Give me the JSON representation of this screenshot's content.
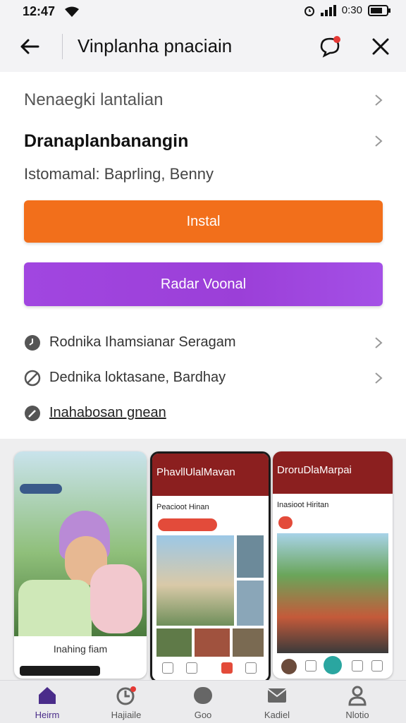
{
  "status": {
    "time": "12:47",
    "battery_text": "0:30"
  },
  "appbar": {
    "title": "Vinplanha pnaciain"
  },
  "rows": {
    "r1": "Nenaegki lantalian",
    "r2": "Dranaplanbanangin",
    "r3": "Istomamal: Baprling, Benny"
  },
  "buttons": {
    "install": "Instal",
    "radar": "Radar Voonal"
  },
  "links": [
    {
      "label": "Rodnika Ihamsianar Seragam"
    },
    {
      "label": "Dednika loktasane, Bardhay"
    },
    {
      "label": "Inahabosan gnean"
    }
  ],
  "shots": [
    {
      "caption": "Inahing fiam"
    },
    {
      "header": "PhavllUlalMavan",
      "sub": "Peacioot Hinan"
    },
    {
      "header": "DroruDlaMarpai",
      "sub": "Inasioot Hiritan"
    }
  ],
  "nav": [
    {
      "label": "Heirm"
    },
    {
      "label": "Hajiaile"
    },
    {
      "label": "Goo"
    },
    {
      "label": "Kadiel"
    },
    {
      "label": "Nlotio"
    }
  ],
  "colors": {
    "install": "#f26f1b",
    "radar": "#a146e0",
    "active_nav": "#4a2c8a"
  }
}
